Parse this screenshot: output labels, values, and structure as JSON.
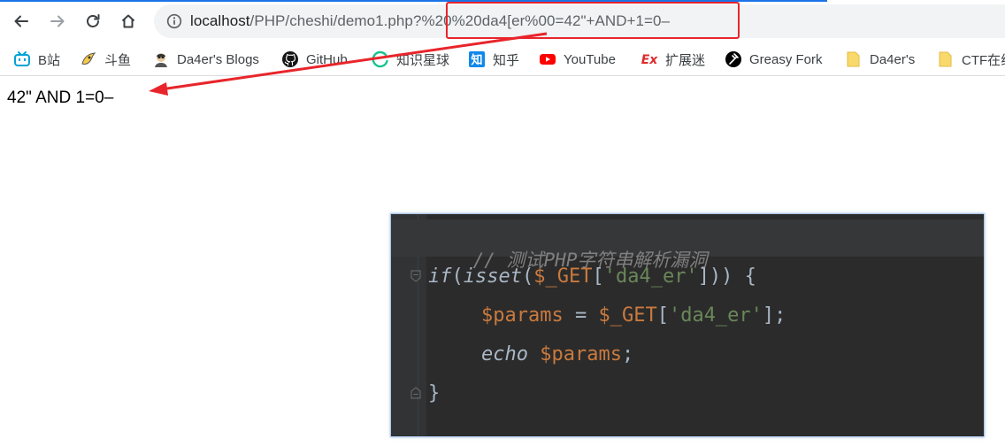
{
  "browser": {
    "url": {
      "host": "localhost",
      "path": "/PHP/cheshi/demo1.php",
      "query": "?%20%20da4[er%00=42\"+AND+1=0–"
    }
  },
  "bookmarks": [
    {
      "label": "B站",
      "icon": "bilibili-icon"
    },
    {
      "label": "斗鱼",
      "icon": "douyu-icon"
    },
    {
      "label": "Da4er's Blogs",
      "icon": "avatar-icon"
    },
    {
      "label": "GitHub",
      "icon": "github-icon"
    },
    {
      "label": "知识星球",
      "icon": "zsxq-icon"
    },
    {
      "label": "知乎",
      "icon": "zhihu-icon"
    },
    {
      "label": "YouTube",
      "icon": "youtube-icon"
    },
    {
      "label": "扩展迷",
      "icon": "extfans-icon"
    },
    {
      "label": "Greasy Fork",
      "icon": "greasyfork-icon"
    },
    {
      "label": "Da4er's",
      "icon": "folder-icon"
    },
    {
      "label": "CTF在线",
      "icon": "folder-icon"
    }
  ],
  "page": {
    "output": "42\" AND 1=0–"
  },
  "code": {
    "comment": "// 测试PHP字符串解析漏洞",
    "line1": {
      "kw": "if",
      "p1": "(",
      "fn": "isset",
      "p2": "(",
      "var": "$_GET",
      "p3": "[",
      "str": "'da4_er'",
      "p4": "])) {"
    },
    "line2": {
      "var1": "$params",
      "op": " = ",
      "var2": "$_GET",
      "p1": "[",
      "str": "'da4_er'",
      "p2": "];"
    },
    "line3": {
      "kw": "echo",
      "sp": " ",
      "var": "$params",
      "p": ";"
    },
    "line4": {
      "p": "}"
    }
  },
  "colors": {
    "annotation": "#e8252b",
    "code_bg": "#2b2b2b",
    "code_var": "#c97a3e",
    "code_str": "#6a8759",
    "code_comment": "#808080"
  }
}
